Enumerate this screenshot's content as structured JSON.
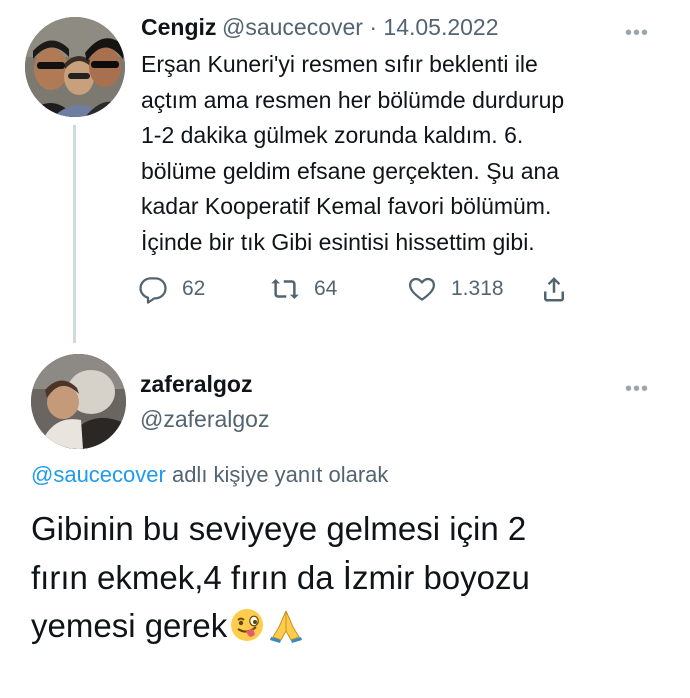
{
  "tweet": {
    "author_name": "Cengiz",
    "author_handle": "@saucecover",
    "date": "14.05.2022",
    "handle_and_date": "@saucecover · 14.05.2022",
    "more_icon": "more-icon",
    "text_lines": [
      "Erşan Kuneri'yi resmen sıfır beklenti ile",
      "açtım ama resmen her bölümde durdurup",
      "1-2 dakika gülmek zorunda kaldım. 6.",
      "bölüme geldim efsane gerçekten. Şu ana",
      "kadar Kooperatif Kemal favori bölümüm.",
      "İçinde bir tık Gibi esintisi hissettim gibi."
    ],
    "actions": {
      "reply_count": "62",
      "retweet_count": "64",
      "like_count": "1.318"
    }
  },
  "reply": {
    "author_name": "zaferalgoz",
    "author_handle": "@zaferalgoz",
    "reply_to_mention": "@saucecover",
    "reply_to_suffix": " adlı kişiye yanıt olarak",
    "text_lines": [
      "Gibinin bu seviyeye gelmesi için 2",
      "fırın ekmek,4 fırın da İzmir boyozu",
      "yemesi gerek"
    ],
    "emojis": [
      "winking-face-with-tongue-emoji",
      "folded-hands-emoji"
    ]
  },
  "colors": {
    "text": "#0f1419",
    "secondary": "#536471",
    "link": "#1d9bf0",
    "thread_line": "#cfd9de"
  }
}
